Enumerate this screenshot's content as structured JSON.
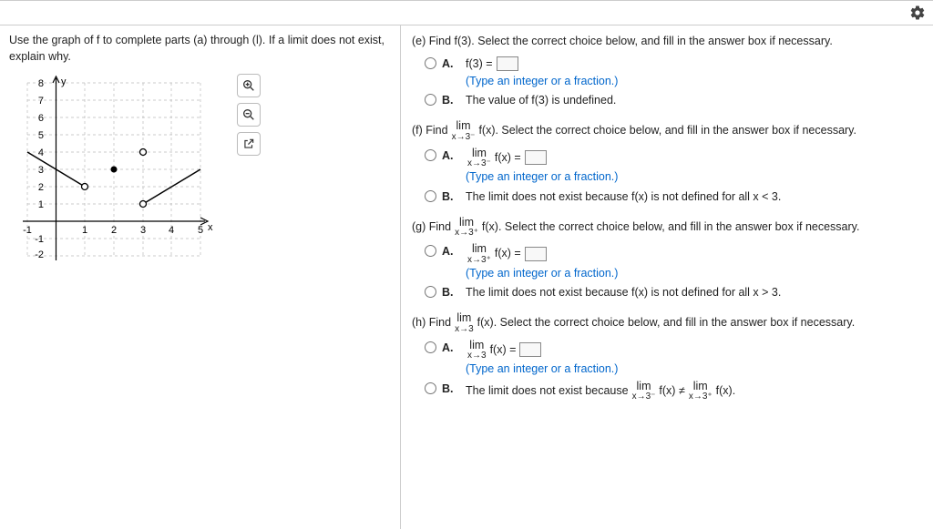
{
  "instructions": "Use the graph of f to complete parts (a) through (l). If a limit does not exist, explain why.",
  "tools": {
    "zoom_in": "zoom-in",
    "zoom_out": "zoom-out",
    "open_new": "open-external"
  },
  "questions": {
    "e": {
      "prompt_prefix": "(e) Find f(3). Select the correct choice below, and fill in the answer box if necessary.",
      "optA_label": "A.",
      "optA_text_pre": "f(3) = ",
      "optA_hint": "(Type an integer or a fraction.)",
      "optB_label": "B.",
      "optB_text": "The value of f(3) is undefined."
    },
    "f": {
      "prompt_pre": "(f) Find ",
      "lim_top": "lim",
      "lim_sub": "x→3⁻",
      "prompt_mid": " f(x). Select the correct choice below, and fill in the answer box if necessary.",
      "optA_label": "A.",
      "optA_lim_top": "lim",
      "optA_lim_sub": "x→3⁻",
      "optA_fx": " f(x) = ",
      "optA_hint": "(Type an integer or a fraction.)",
      "optB_label": "B.",
      "optB_text": "The limit does not exist because f(x) is not defined for all x < 3."
    },
    "g": {
      "prompt_pre": "(g) Find ",
      "lim_top": "lim",
      "lim_sub": "x→3⁺",
      "prompt_mid": " f(x). Select the correct choice below, and fill in the answer box if necessary.",
      "optA_label": "A.",
      "optA_lim_top": "lim",
      "optA_lim_sub": "x→3⁺",
      "optA_fx": " f(x) = ",
      "optA_hint": "(Type an integer or a fraction.)",
      "optB_label": "B.",
      "optB_text": "The limit does not exist because f(x) is not defined for all x > 3."
    },
    "h": {
      "prompt_pre": "(h) Find ",
      "lim_top": "lim",
      "lim_sub": "x→3",
      "prompt_mid": " f(x). Select the correct choice below, and fill in the answer box if necessary.",
      "optA_label": "A.",
      "optA_lim_top": "lim",
      "optA_lim_sub": "x→3",
      "optA_fx": " f(x) = ",
      "optA_hint": "(Type an integer or a fraction.)",
      "optB_label": "B.",
      "optB_pre": "The limit does not exist because ",
      "optB_l1_top": "lim",
      "optB_l1_sub": "x→3⁻",
      "optB_mid": " f(x) ≠ ",
      "optB_l2_top": "lim",
      "optB_l2_sub": "x→3⁺",
      "optB_post": " f(x)."
    }
  },
  "chart_data": {
    "type": "line",
    "xlabel": "x",
    "ylabel": "y",
    "xlim": [
      -1,
      5
    ],
    "ylim": [
      -2,
      8
    ],
    "x_ticks": [
      -1,
      1,
      2,
      3,
      4,
      5
    ],
    "y_ticks": [
      -2,
      -1,
      1,
      2,
      3,
      4,
      5,
      6,
      7,
      8
    ],
    "segments": [
      {
        "from": [
          -1,
          4
        ],
        "to": [
          1,
          2
        ],
        "left_open": false,
        "right_open": true
      },
      {
        "from": [
          3,
          1
        ],
        "to": [
          5,
          3
        ],
        "left_open": true,
        "right_open": false
      }
    ],
    "points": [
      {
        "x": 1,
        "y": 2,
        "filled": false
      },
      {
        "x": 2,
        "y": 3,
        "filled": true
      },
      {
        "x": 3,
        "y": 4,
        "filled": false
      },
      {
        "x": 3,
        "y": 1,
        "filled": false
      }
    ]
  }
}
